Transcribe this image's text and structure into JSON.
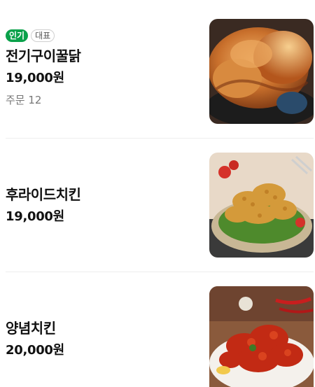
{
  "menu": {
    "items": [
      {
        "badges": {
          "popular": "인기",
          "representative": "대표"
        },
        "name": "전기구이꿀닭",
        "price": "19,000원",
        "orders": "주문 12",
        "image_icon": "roast-chicken-photo"
      },
      {
        "name": "후라이드치킨",
        "price": "19,000원",
        "image_icon": "fried-chicken-photo"
      },
      {
        "name": "양념치킨",
        "price": "20,000원",
        "image_icon": "seasoned-chicken-photo"
      }
    ]
  },
  "colors": {
    "popular_badge": "#0aa14a",
    "text": "#111111",
    "muted": "#777777",
    "divider": "#eeeeee"
  }
}
